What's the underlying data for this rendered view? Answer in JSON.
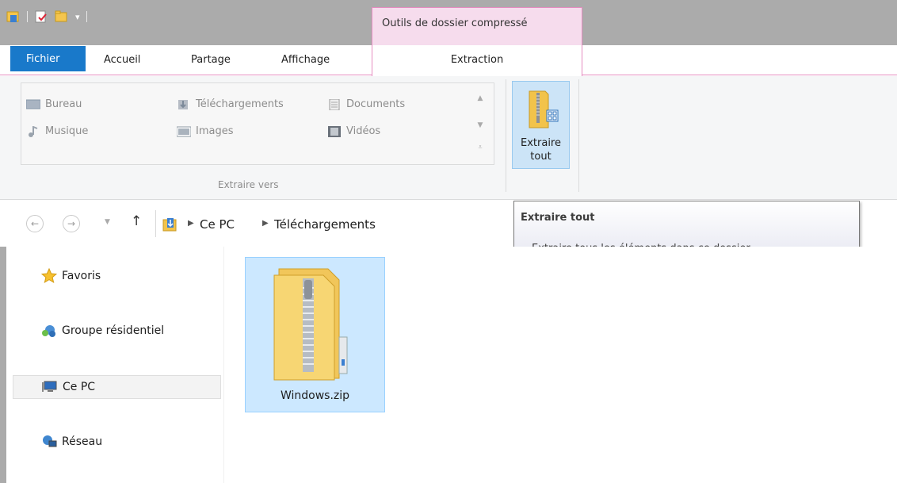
{
  "context_tab": {
    "title": "Outils de dossier compressé"
  },
  "tabs": {
    "file": "Fichier",
    "home": "Accueil",
    "share": "Partage",
    "view": "Affichage",
    "extract": "Extraction"
  },
  "ribbon": {
    "extract_to": {
      "items": {
        "desktop": "Bureau",
        "downloads": "Téléchargements",
        "documents": "Documents",
        "music": "Musique",
        "pictures": "Images",
        "videos": "Vidéos"
      },
      "group_label": "Extraire vers"
    },
    "extract_all": {
      "line1": "Extraire",
      "line2": "tout"
    }
  },
  "address": {
    "crumbs": [
      "Ce PC",
      "Téléchargements"
    ]
  },
  "tooltip": {
    "title": "Extraire tout",
    "description": "Extraire tous les éléments dans ce dossier."
  },
  "nav": {
    "favorites": "Favoris",
    "homegroup": "Groupe résidentiel",
    "this_pc": "Ce PC",
    "network": "Réseau"
  },
  "content": {
    "file_name": "Windows.zip"
  },
  "icons": {
    "folder": "folder-icon",
    "zip": "zip-folder-icon",
    "star": "star-icon"
  }
}
